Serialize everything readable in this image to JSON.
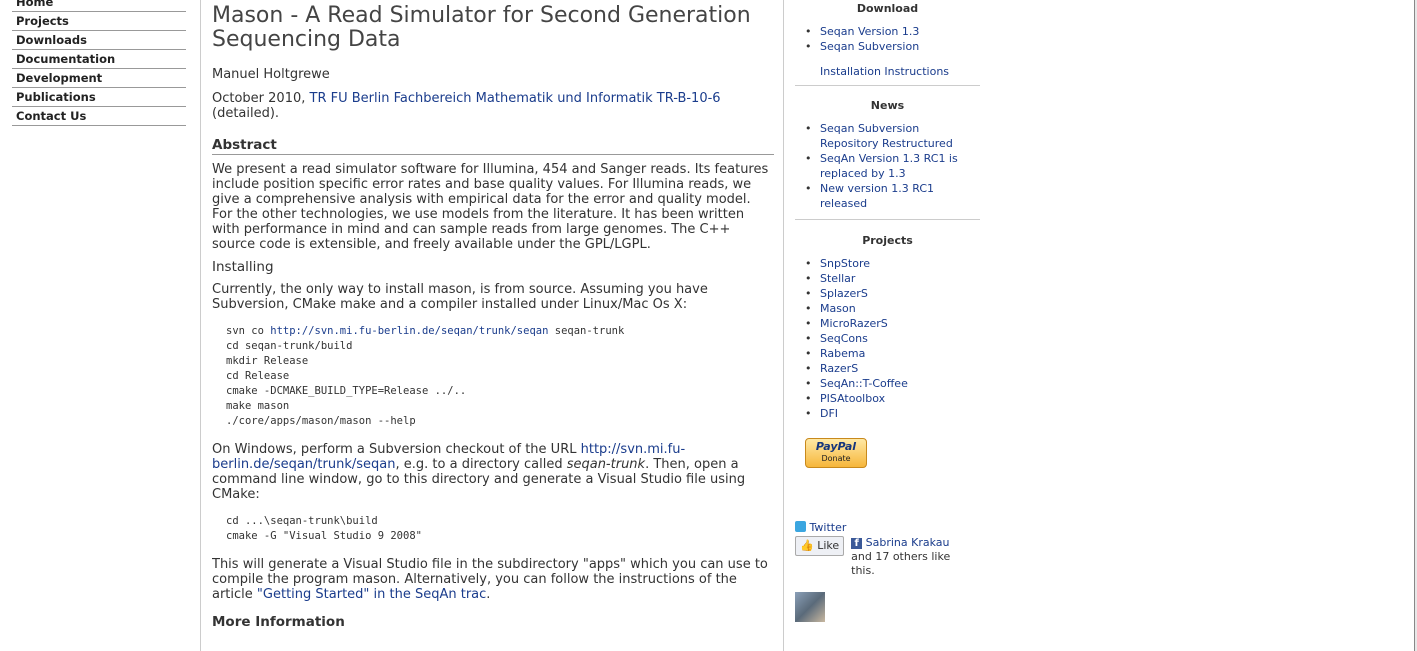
{
  "nav": {
    "items": [
      {
        "label": "Home"
      },
      {
        "label": "Projects"
      },
      {
        "label": "Downloads"
      },
      {
        "label": "Documentation"
      },
      {
        "label": "Development"
      },
      {
        "label": "Publications"
      },
      {
        "label": "Contact Us"
      }
    ]
  },
  "article": {
    "title": "Mason - A Read Simulator for Second Generation Sequencing Data",
    "author": "Manuel Holtgrewe",
    "date": "October 2010,",
    "report_link": "TR FU Berlin Fachbereich Mathematik und Informatik TR-B-10-6",
    "detailed": "(detailed).",
    "abstract_heading": "Abstract",
    "abstract_text": "We present a read simulator software for Illumina, 454 and Sanger reads. Its features include position specific error rates and base quality values. For Illumina reads, we give a comprehensive analysis with empirical data for the error and quality model. For the other technologies, we use models from the literature. It has been written with performance in mind and can sample reads from large genomes. The C++ source code is extensible, and freely available under the GPL/LGPL.",
    "installing_heading": "Installing",
    "install_intro": "Currently, the only way to install mason, is from source. Assuming you have Subversion, CMake make and a compiler installed under Linux/Mac Os X:",
    "code1": {
      "line1_pre": "svn co ",
      "line1_link": "http://svn.mi.fu-berlin.de/seqan/trunk/seqan",
      "line1_post": " seqan-trunk",
      "rest": "cd seqan-trunk/build\nmkdir Release\ncd Release\ncmake -DCMAKE_BUILD_TYPE=Release ../..\nmake mason\n./core/apps/mason/mason --help"
    },
    "windows_pre": "On Windows, perform a Subversion checkout of the URL ",
    "windows_link": "http://svn.mi.fu-berlin.de/seqan/trunk/seqan",
    "windows_mid": ", e.g. to a directory called ",
    "windows_em": "seqan-trunk",
    "windows_post": ". Then, open a command line window, go to this directory and generate a Visual Studio file using CMake:",
    "code2": "cd ...\\seqan-trunk\\build\ncmake -G \"Visual Studio 9 2008\"",
    "vs_pre": "This will generate a Visual Studio file in the subdirectory \"apps\" which you can use to compile the program mason. Alternatively, you can follow the instructions of the article ",
    "vs_link": "\"Getting Started\" in the SeqAn trac",
    "vs_post": ".",
    "more_heading": "More Information"
  },
  "sidebar": {
    "download": {
      "title": "Download",
      "items": [
        "Seqan Version 1.3",
        "Seqan Subversion"
      ],
      "instructions": "Installation Instructions"
    },
    "news": {
      "title": "News",
      "items": [
        "Seqan Subversion Repository Restructured",
        "SeqAn Version 1.3 RC1 is replaced by 1.3",
        "New version 1.3 RC1 released"
      ]
    },
    "projects": {
      "title": "Projects",
      "items": [
        "SnpStore",
        "Stellar",
        "SplazerS",
        "Mason",
        "MicroRazerS",
        "SeqCons",
        "Rabema",
        "RazerS",
        "SeqAn::T-Coffee",
        "PISAtoolbox",
        "DFI"
      ]
    },
    "paypal": {
      "logo": "PayPal",
      "label": "Donate"
    },
    "twitter": "Twitter",
    "like_button": "Like",
    "facebook_icon": "f",
    "like_name": "Sabrina Krakau",
    "like_rest": " and 17 others like this."
  }
}
